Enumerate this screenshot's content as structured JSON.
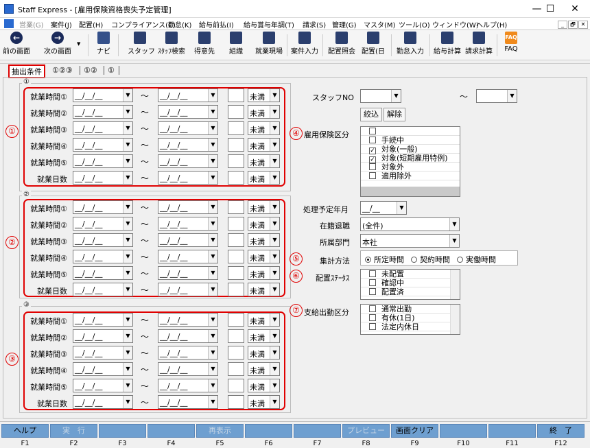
{
  "window": {
    "title": "Staff Express - [雇用保険資格喪失予定管理]",
    "minimize": "—",
    "maximize": "☐",
    "close": "✕"
  },
  "menu": [
    "営業(G)",
    "案件(J)",
    "配置(H)",
    "コンプライアンス(C)",
    "勤怠(K)",
    "給与前払(I)",
    "給与賞与年調(T)",
    "請求(S)",
    "管理(G)",
    "マスタ(M)",
    "ツール(O)",
    "ウィンドウ(W)",
    "ヘルプ(H)"
  ],
  "mdi_controls": [
    "_",
    "🗗",
    "✕"
  ],
  "toolbar": {
    "prev": "前の画面",
    "next": "次の画面",
    "navi": "ナビ",
    "staff": "スタッフ",
    "staff_search": "ｽﾀｯﾌ検索",
    "client": "得意先",
    "org": "組織",
    "site": "就業現場",
    "case": "案件入力",
    "placement_inquiry": "配置照会",
    "placement": "配置(日",
    "attendance": "勤怠入力",
    "pay_calc": "給与計算",
    "invoice_calc": "請求計算",
    "faq": "FAQ"
  },
  "tabs": [
    "抽出条件",
    "①②③",
    "①②",
    "①"
  ],
  "groups": [
    {
      "label": "①",
      "marker": "①",
      "rows": [
        {
          "label": "就業時間①",
          "from": "__/__/__",
          "to": "__/__/__",
          "cond": "未満"
        },
        {
          "label": "就業時間②",
          "from": "__/__/__",
          "to": "__/__/__",
          "cond": "未満"
        },
        {
          "label": "就業時間③",
          "from": "__/__/__",
          "to": "__/__/__",
          "cond": "未満"
        },
        {
          "label": "就業時間④",
          "from": "__/__/__",
          "to": "__/__/__",
          "cond": "未満"
        },
        {
          "label": "就業時間⑤",
          "from": "__/__/__",
          "to": "__/__/__",
          "cond": "未満"
        },
        {
          "label": "就業日数",
          "from": "__/__/__",
          "to": "__/__/__",
          "cond": "未満"
        }
      ]
    },
    {
      "label": "②",
      "marker": "②",
      "rows": [
        {
          "label": "就業時間①",
          "from": "__/__/__",
          "to": "__/__/__",
          "cond": "未満"
        },
        {
          "label": "就業時間②",
          "from": "__/__/__",
          "to": "__/__/__",
          "cond": "未満"
        },
        {
          "label": "就業時間③",
          "from": "__/__/__",
          "to": "__/__/__",
          "cond": "未満"
        },
        {
          "label": "就業時間④",
          "from": "__/__/__",
          "to": "__/__/__",
          "cond": "未満"
        },
        {
          "label": "就業時間⑤",
          "from": "__/__/__",
          "to": "__/__/__",
          "cond": "未満"
        },
        {
          "label": "就業日数",
          "from": "__/__/__",
          "to": "__/__/__",
          "cond": "未満"
        }
      ]
    },
    {
      "label": "③",
      "marker": "③",
      "rows": [
        {
          "label": "就業時間①",
          "from": "__/__/__",
          "to": "__/__/__",
          "cond": "未満"
        },
        {
          "label": "就業時間②",
          "from": "__/__/__",
          "to": "__/__/__",
          "cond": "未満"
        },
        {
          "label": "就業時間③",
          "from": "__/__/__",
          "to": "__/__/__",
          "cond": "未満"
        },
        {
          "label": "就業時間④",
          "from": "__/__/__",
          "to": "__/__/__",
          "cond": "未満"
        },
        {
          "label": "就業時間⑤",
          "from": "__/__/__",
          "to": "__/__/__",
          "cond": "未満"
        },
        {
          "label": "就業日数",
          "from": "__/__/__",
          "to": "__/__/__",
          "cond": "未満"
        }
      ]
    }
  ],
  "tilde": "～",
  "right": {
    "staff_no_label": "スタッフNO",
    "staff_no_tilde": "～",
    "filter_btn": "絞込",
    "clear_btn": "解除",
    "koyo_marker": "④",
    "koyo_label": "雇用保険区分",
    "koyo_items": [
      {
        "label": "",
        "checked": false
      },
      {
        "label": "手続中",
        "checked": false
      },
      {
        "label": "対象(一般)",
        "checked": true
      },
      {
        "label": "対象(短期雇用特例)",
        "checked": true
      },
      {
        "label": "対象外",
        "checked": false
      },
      {
        "label": "適用除外",
        "checked": false
      }
    ],
    "ym_label": "処理予定年月",
    "ym_value": "__/__",
    "zaiseki_label": "在籍退職",
    "zaiseki_value": "(全件)",
    "busho_label": "所属部門",
    "busho_value": "本社",
    "shukei_marker": "⑤",
    "shukei_label": "集計方法",
    "shukei_options": [
      {
        "label": "所定時間",
        "on": true
      },
      {
        "label": "契約時間",
        "on": false
      },
      {
        "label": "実働時間",
        "on": false
      }
    ],
    "haichi_marker": "⑥",
    "haichi_label": "配置ｽﾃｰﾀｽ",
    "haichi_items": [
      {
        "label": "未配置",
        "checked": false
      },
      {
        "label": "確認中",
        "checked": false
      },
      {
        "label": "配置済",
        "checked": false
      }
    ],
    "shikyu_marker": "⑦",
    "shikyu_label": "支給出勤区分",
    "shikyu_items": [
      {
        "label": "通常出勤",
        "checked": false
      },
      {
        "label": "有休(1日)",
        "checked": false
      },
      {
        "label": "法定内休日",
        "checked": false
      }
    ]
  },
  "fkeys": [
    {
      "label": "ヘルプ",
      "key": "F1",
      "disabled": false
    },
    {
      "label": "実　行",
      "key": "F2",
      "disabled": true
    },
    {
      "label": "",
      "key": "F3",
      "disabled": false
    },
    {
      "label": "",
      "key": "F4",
      "disabled": false
    },
    {
      "label": "再表示",
      "key": "F5",
      "disabled": true
    },
    {
      "label": "",
      "key": "F6",
      "disabled": false
    },
    {
      "label": "",
      "key": "F7",
      "disabled": false
    },
    {
      "label": "プレビュー",
      "key": "F8",
      "disabled": true
    },
    {
      "label": "画面クリア",
      "key": "F9",
      "disabled": false
    },
    {
      "label": "",
      "key": "F10",
      "disabled": false
    },
    {
      "label": "",
      "key": "F11",
      "disabled": false
    },
    {
      "label": "終　了",
      "key": "F12",
      "disabled": false
    }
  ]
}
